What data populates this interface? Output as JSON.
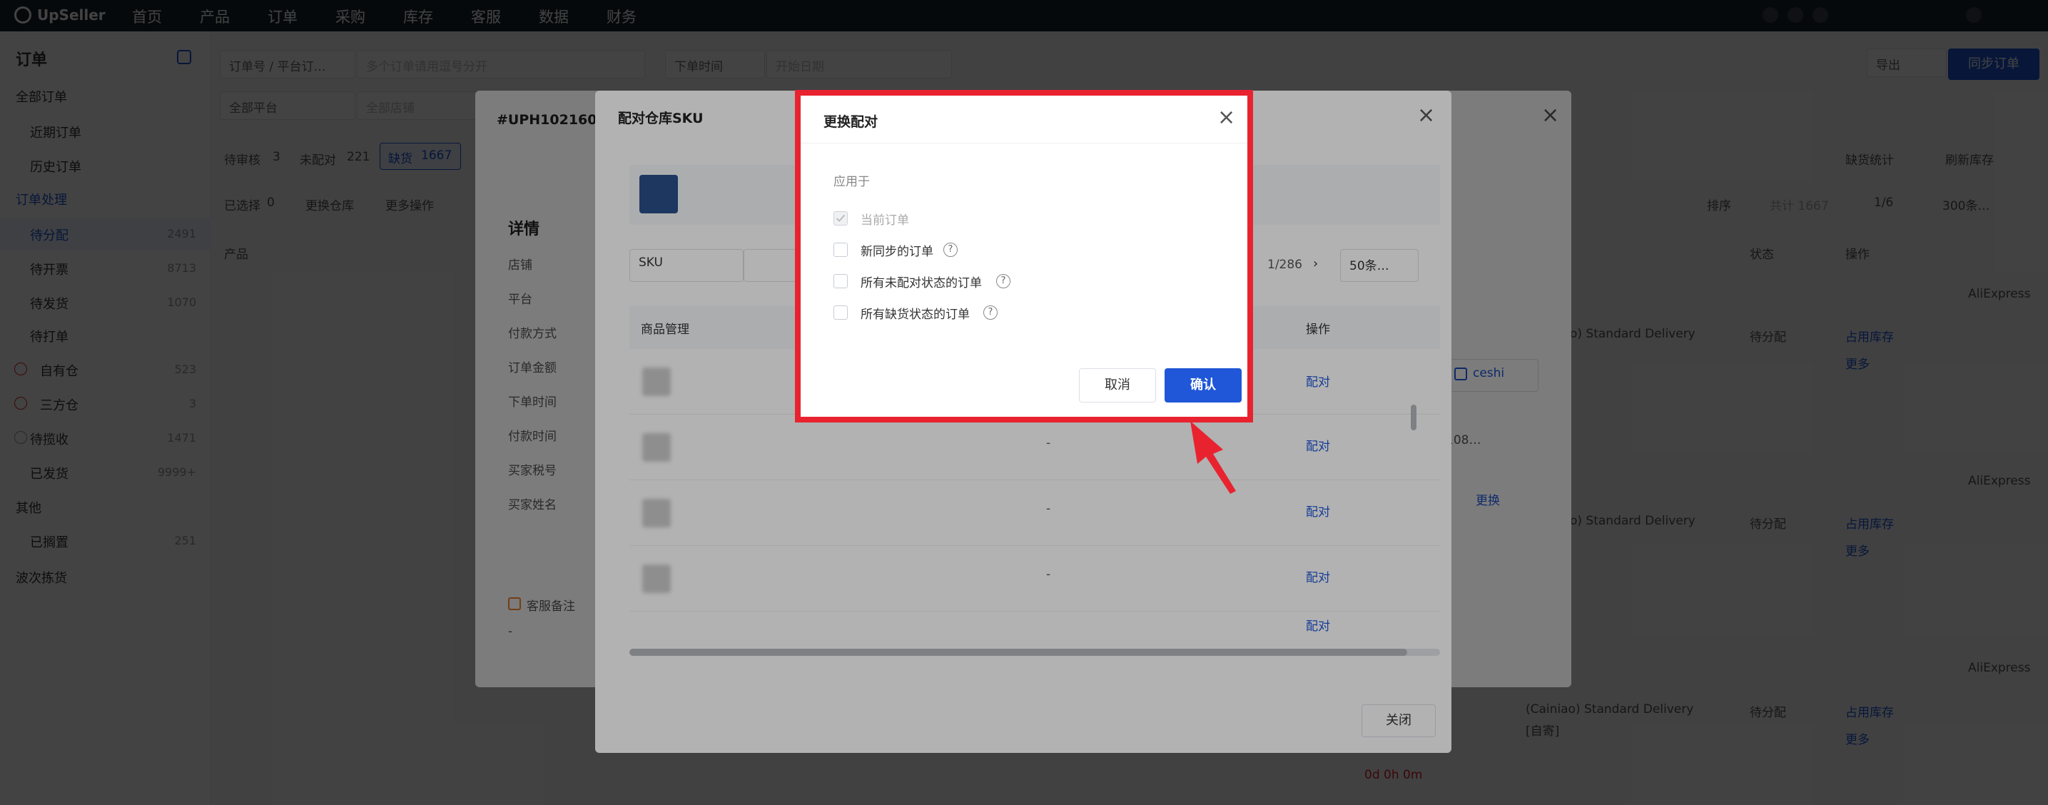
{
  "topnav": {
    "brand": "UpSeller",
    "items": [
      "首页",
      "产品",
      "订单",
      "采购",
      "库存",
      "客服",
      "数据",
      "财务"
    ]
  },
  "sidebar": {
    "title": "订单",
    "sections": [
      {
        "label": "全部订单",
        "items": [
          {
            "label": "近期订单"
          },
          {
            "label": "历史订单"
          }
        ]
      },
      {
        "label": "订单处理",
        "items": [
          {
            "label": "待分配",
            "count": "2491"
          },
          {
            "label": "待开票",
            "count": "8713"
          },
          {
            "label": "待发货",
            "count": "1070"
          },
          {
            "label": "待打单"
          },
          {
            "label": "自有仓",
            "count": "523"
          },
          {
            "label": "三方仓",
            "count": "3"
          },
          {
            "label": "待揽收",
            "count": "1471"
          },
          {
            "label": "已发货",
            "count": "9999+"
          }
        ]
      },
      {
        "label": "其他",
        "items": [
          {
            "label": "已搁置",
            "count": "251"
          }
        ]
      }
    ],
    "bottom": "波次拣货"
  },
  "main": {
    "search_type": "订单号 / 平台订…",
    "search_placeholder": "多个订单请用逗号分开",
    "time_filter": "下单时间",
    "date_placeholder": "开始日期",
    "platform_filter": "全部平台",
    "shop_filter": "全部店铺",
    "export_label": "导出",
    "sync_label": "同步订单",
    "status_tabs": [
      {
        "label": "待审核",
        "count": "3"
      },
      {
        "label": "未配对",
        "count": "221"
      },
      {
        "label": "缺货",
        "count": "1667"
      }
    ],
    "selected_label": "已选择",
    "selected_count": "0",
    "change_warehouse": "更换仓库",
    "more_actions": "更多操作",
    "out_of_stock_stats": "缺货统计",
    "refresh_stock": "刷新库存",
    "sort_label": "排序",
    "total_label": "共计 1667",
    "page_indicator": "1/6",
    "page_size": "300条…",
    "columns": [
      "产品",
      "状态",
      "操作"
    ],
    "rows": [
      {
        "platform": "AliExpress",
        "delivery": "o) Standard Delivery",
        "status": "待分配",
        "action1": "占用库存",
        "action2": "更多"
      },
      {
        "platform": "AliExpress",
        "delivery": "o) Standard Delivery",
        "status": "待分配",
        "action1": "占用库存",
        "action2": "更多"
      },
      {
        "platform": "AliExpress",
        "delivery": "(Cainiao) Standard Delivery",
        "delivery_note": "[自寄]",
        "status": "待分配",
        "action1": "占用库存",
        "action2": "更多",
        "countdown": "0d 0h 0m"
      }
    ]
  },
  "detail_modal": {
    "order_id": "#UPH102160",
    "heading": "详情",
    "fields": [
      "店铺",
      "平台",
      "付款方式",
      "订单金额",
      "下单时间",
      "付款时间",
      "买家税号",
      "买家姓名"
    ],
    "service_note": "客服备注",
    "service_note_value": "-",
    "warehouse_tag": "ceshi",
    "truncated": "108…",
    "change_link": "更换"
  },
  "sku_modal": {
    "title": "配对仓库SKU",
    "search_type": "SKU",
    "page_indicator": "1/286",
    "page_size": "50条…",
    "columns": {
      "product": "商品管理",
      "action": "操作"
    },
    "rows": [
      {
        "dash": "",
        "action": "配对"
      },
      {
        "dash": "-",
        "action": "配对"
      },
      {
        "dash": "-",
        "action": "配对"
      },
      {
        "dash": "-",
        "action": "配对"
      },
      {
        "dash": "",
        "action": "配对"
      }
    ],
    "close_label": "关闭"
  },
  "change_pair_dialog": {
    "title": "更换配对",
    "apply_to": "应用于",
    "options": [
      {
        "label": "当前订单",
        "checked": true,
        "disabled": true,
        "help": false
      },
      {
        "label": "新同步的订单",
        "checked": false,
        "disabled": false,
        "help": true
      },
      {
        "label": "所有未配对状态的订单",
        "checked": false,
        "disabled": false,
        "help": true
      },
      {
        "label": "所有缺货状态的订单",
        "checked": false,
        "disabled": false,
        "help": true
      }
    ],
    "cancel_label": "取消",
    "confirm_label": "确认"
  },
  "colors": {
    "accent": "#1f57d8",
    "highlight": "#e8232f",
    "nav_bg": "#1d2330"
  }
}
